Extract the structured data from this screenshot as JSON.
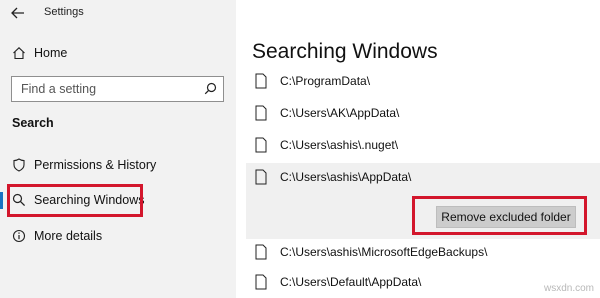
{
  "window": {
    "title": "Settings"
  },
  "nav": {
    "home_label": "Home",
    "search": {
      "placeholder": "Find a setting"
    },
    "section_heading": "Search",
    "items": [
      {
        "label": "Permissions & History",
        "icon": "shield-icon"
      },
      {
        "label": "Searching Windows",
        "icon": "search-icon",
        "active": true
      },
      {
        "label": "More details",
        "icon": "info-icon"
      }
    ]
  },
  "main": {
    "title": "Searching Windows",
    "excluded_folders": [
      "C:\\ProgramData\\",
      "C:\\Users\\AK\\AppData\\",
      "C:\\Users\\ashis\\.nuget\\",
      "C:\\Users\\ashis\\AppData\\",
      "C:\\Users\\ashis\\MicrosoftEdgeBackups\\",
      "C:\\Users\\Default\\AppData\\"
    ],
    "remove_button_label": "Remove excluded folder"
  },
  "watermark": "wsxdn.com",
  "colors": {
    "highlight": "#d3162c",
    "accent": "#1a73c2",
    "nav_bg": "#f2f2f2"
  }
}
